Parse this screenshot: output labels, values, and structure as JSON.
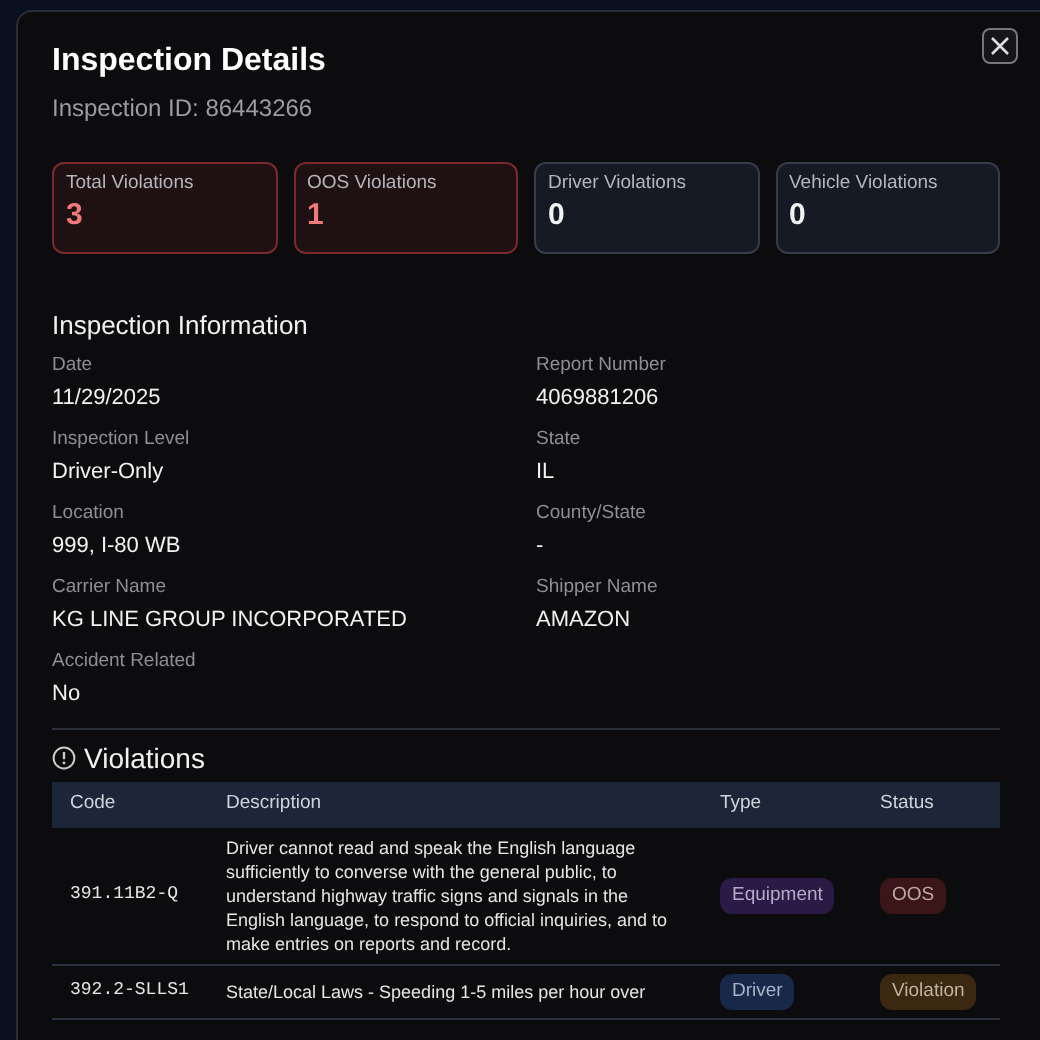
{
  "modal": {
    "title": "Inspection Details",
    "subtitle": "Inspection ID: 86443266"
  },
  "stats": [
    {
      "label": "Total Violations",
      "value": "3",
      "kind": "alert"
    },
    {
      "label": "OOS Violations",
      "value": "1",
      "kind": "alert"
    },
    {
      "label": "Driver Violations",
      "value": "0",
      "kind": "neutral"
    },
    {
      "label": "Vehicle Violations",
      "value": "0",
      "kind": "neutral"
    }
  ],
  "info": {
    "heading": "Inspection Information",
    "fields": [
      {
        "label": "Date",
        "value": "11/29/2025"
      },
      {
        "label": "Report Number",
        "value": "4069881206"
      },
      {
        "label": "Inspection Level",
        "value": "Driver-Only"
      },
      {
        "label": "State",
        "value": "IL"
      },
      {
        "label": "Location",
        "value": "999, I-80 WB"
      },
      {
        "label": "County/State",
        "value": "-"
      },
      {
        "label": "Carrier Name",
        "value": "KG LINE GROUP INCORPORATED"
      },
      {
        "label": "Shipper Name",
        "value": "AMAZON"
      },
      {
        "label": "Accident Related",
        "value": "No"
      }
    ]
  },
  "violations": {
    "heading": "Violations",
    "columns": [
      "Code",
      "Description",
      "Type",
      "Status"
    ],
    "rows": [
      {
        "code": "391.11B2-Q",
        "description": "Driver cannot read and speak the English language sufficiently to converse with the general public, to understand highway traffic signs and signals in the English language, to respond to official inquiries, and to make entries on reports and record.",
        "type": {
          "text": "Equipment",
          "color": "#2a1a45"
        },
        "status": {
          "text": "OOS",
          "color": "#3a1618"
        }
      },
      {
        "code": "392.2-SLLS1",
        "description": "State/Local Laws - Speeding 1-5 miles per hour over",
        "type": {
          "text": "Driver",
          "color": "#172848"
        },
        "status": {
          "text": "Violation",
          "color": "#3a2810"
        }
      }
    ]
  }
}
